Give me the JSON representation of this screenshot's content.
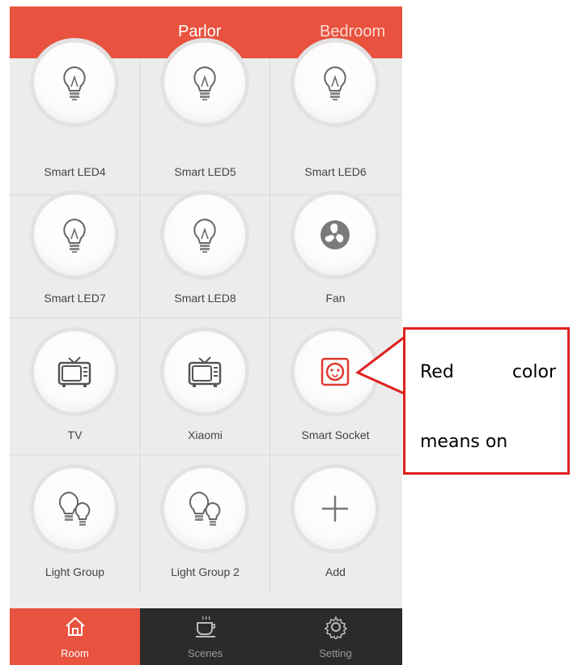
{
  "header": {
    "tabs": [
      "Parlor",
      "Bedroom"
    ],
    "active_tab": "Parlor",
    "accent": "#e8523e"
  },
  "devices": [
    {
      "label": "Smart LED4",
      "icon": "bulb-icon"
    },
    {
      "label": "Smart LED5",
      "icon": "bulb-icon"
    },
    {
      "label": "Smart LED6",
      "icon": "bulb-icon"
    },
    {
      "label": "Smart LED7",
      "icon": "bulb-icon"
    },
    {
      "label": "Smart LED8",
      "icon": "bulb-icon"
    },
    {
      "label": "Fan",
      "icon": "fan-icon"
    },
    {
      "label": "TV",
      "icon": "tv-icon"
    },
    {
      "label": "Xiaomi",
      "icon": "tv-icon"
    },
    {
      "label": "Smart Socket",
      "icon": "socket-icon",
      "state": "on"
    },
    {
      "label": "Light Group",
      "icon": "bulb-group-icon"
    },
    {
      "label": "Light Group 2",
      "icon": "bulb-group-icon"
    },
    {
      "label": "Add",
      "icon": "plus-icon"
    }
  ],
  "bottom_nav": [
    {
      "label": "Room",
      "icon": "home-icon",
      "active": true
    },
    {
      "label": "Scenes",
      "icon": "cup-icon",
      "active": false
    },
    {
      "label": "Setting",
      "icon": "gear-icon",
      "active": false
    }
  ],
  "callout": {
    "word1": "Red",
    "word2": "color",
    "line2": "means on",
    "border_color": "#e02020"
  }
}
